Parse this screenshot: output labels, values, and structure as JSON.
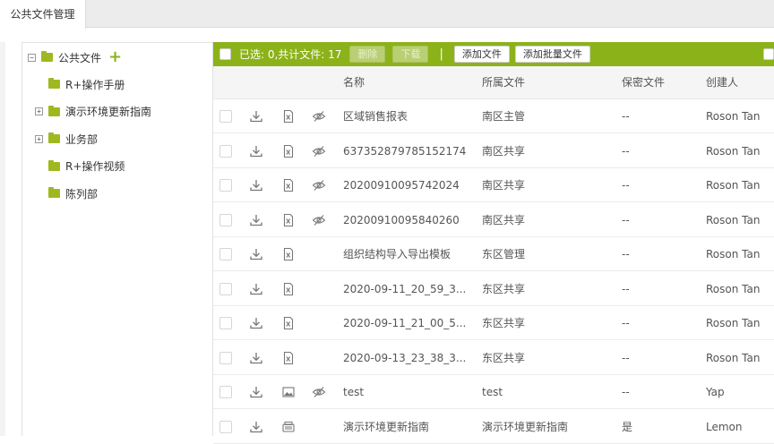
{
  "tab": {
    "label": "公共文件管理"
  },
  "tree": {
    "root": {
      "label": "公共文件",
      "toggle": "−",
      "add_icon": "plus-icon"
    },
    "items": [
      {
        "label": "R+操作手册",
        "toggle": ""
      },
      {
        "label": "演示环境更新指南",
        "toggle": "+"
      },
      {
        "label": "业务部",
        "toggle": "+"
      },
      {
        "label": "R+操作视频",
        "toggle": ""
      },
      {
        "label": "陈列部",
        "toggle": ""
      }
    ]
  },
  "toolbar": {
    "selected_text": "已选: 0,共计文件: 17",
    "delete_label": "删除",
    "download_label": "下载",
    "separator": "|",
    "add_file_label": "添加文件",
    "batch_add_label": "添加批量文件"
  },
  "table": {
    "columns": {
      "name": "名称",
      "folder": "所属文件",
      "secret": "保密文件",
      "creator": "创建人"
    },
    "rows": [
      {
        "name": "区域销售报表",
        "folder": "南区主管",
        "secret": "--",
        "creator": "Roson Tan",
        "type": "excel",
        "eye": true
      },
      {
        "name": "637352879785152174",
        "folder": "南区共享",
        "secret": "--",
        "creator": "Roson Tan",
        "type": "excel",
        "eye": true
      },
      {
        "name": "20200910095742024",
        "folder": "南区共享",
        "secret": "--",
        "creator": "Roson Tan",
        "type": "excel",
        "eye": true
      },
      {
        "name": "20200910095840260",
        "folder": "南区共享",
        "secret": "--",
        "creator": "Roson Tan",
        "type": "excel",
        "eye": true
      },
      {
        "name": "组织结构导入导出模板",
        "folder": "东区管理",
        "secret": "--",
        "creator": "Roson Tan",
        "type": "excel",
        "eye": false
      },
      {
        "name": "2020-09-11_20_59_3...",
        "folder": "东区共享",
        "secret": "--",
        "creator": "Roson Tan",
        "type": "excel",
        "eye": false
      },
      {
        "name": "2020-09-11_21_00_5...",
        "folder": "东区共享",
        "secret": "--",
        "creator": "Roson Tan",
        "type": "excel",
        "eye": false
      },
      {
        "name": "2020-09-13_23_38_3...",
        "folder": "东区共享",
        "secret": "--",
        "creator": "Roson Tan",
        "type": "excel",
        "eye": false
      },
      {
        "name": "test",
        "folder": "test",
        "secret": "--",
        "creator": "Yap",
        "type": "image",
        "eye": true
      },
      {
        "name": "演示环境更新指南",
        "folder": "演示环境更新指南",
        "secret": "是",
        "creator": "Lemon",
        "type": "other",
        "eye": false
      }
    ]
  },
  "colors": {
    "accent": "#8cb21a"
  }
}
